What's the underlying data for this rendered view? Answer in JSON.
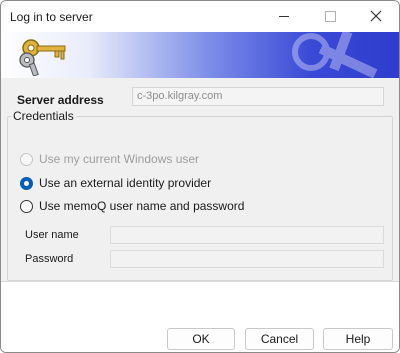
{
  "window": {
    "title": "Log in to server"
  },
  "server": {
    "label": "Server address",
    "value": "c-3po.kilgray.com"
  },
  "credentials": {
    "legend": "Credentials",
    "options": [
      {
        "label": "Use my current Windows user",
        "state": "disabled"
      },
      {
        "label": "Use an external identity provider",
        "state": "checked"
      },
      {
        "label": "Use memoQ user name and password",
        "state": "unchecked"
      }
    ],
    "username_label": "User name",
    "username_value": "",
    "password_label": "Password",
    "password_value": ""
  },
  "buttons": {
    "ok": "OK",
    "cancel": "Cancel",
    "help": "Help"
  },
  "colors": {
    "accent": "#005fb8",
    "banner_end": "#2f3ccd"
  },
  "icons": [
    "keys-icon",
    "minimize-icon",
    "maximize-icon",
    "close-icon"
  ]
}
